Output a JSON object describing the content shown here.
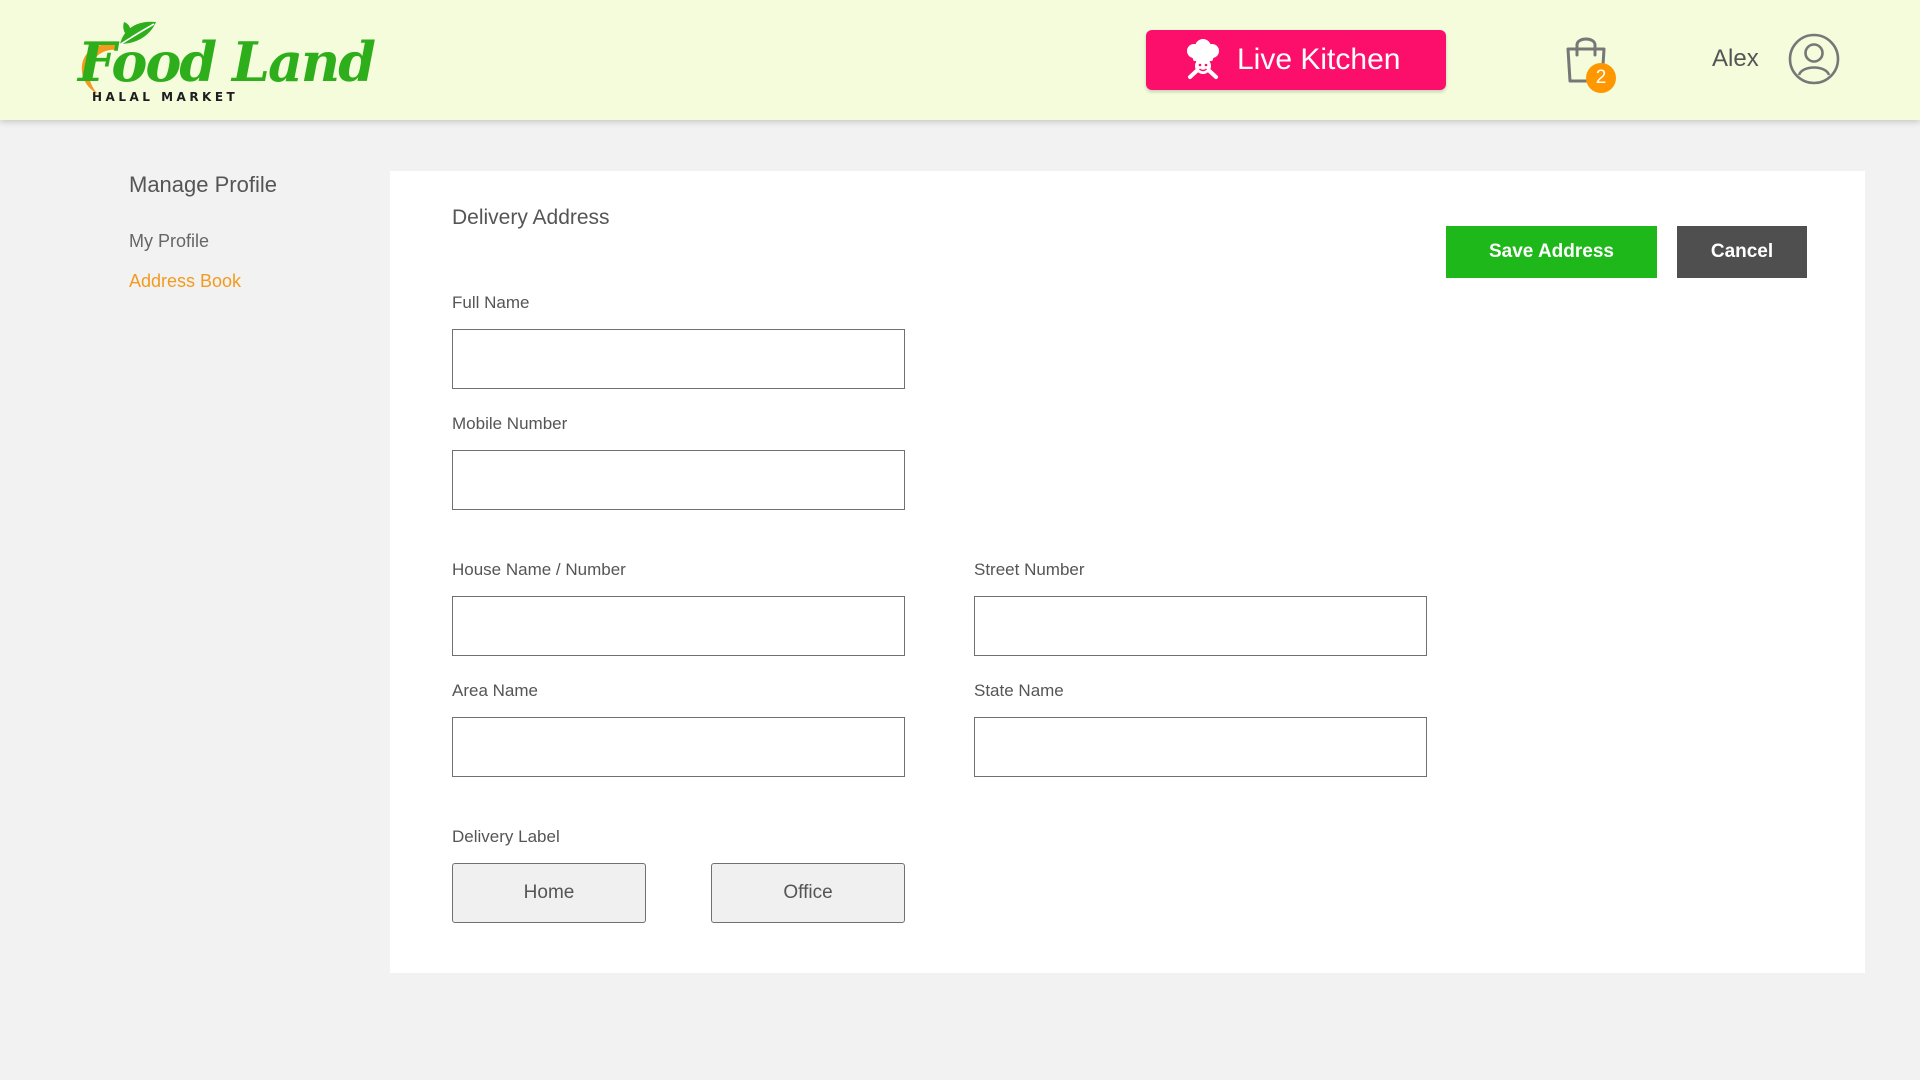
{
  "header": {
    "logo": {
      "title": "Food Land",
      "subtitle": "HALAL MARKET"
    },
    "live_kitchen_label": "Live Kitchen",
    "cart": {
      "icon": "shopping-bag-icon",
      "count": "2"
    },
    "user": {
      "name": "Alex",
      "icon": "user-circle-icon"
    }
  },
  "sidebar": {
    "title": "Manage Profile",
    "items": [
      {
        "label": "My Profile",
        "active": false
      },
      {
        "label": "Address Book",
        "active": true
      }
    ]
  },
  "form": {
    "title": "Delivery Address",
    "save_label": "Save Address",
    "cancel_label": "Cancel",
    "fields": {
      "full_name": {
        "label": "Full Name",
        "value": "",
        "placeholder": ""
      },
      "mobile": {
        "label": "Mobile Number",
        "value": "",
        "placeholder": ""
      },
      "house": {
        "label": "House Name / Number",
        "value": "",
        "placeholder": ""
      },
      "street": {
        "label": "Street Number",
        "value": "",
        "placeholder": ""
      },
      "area": {
        "label": "Area Name",
        "value": "",
        "placeholder": ""
      },
      "state": {
        "label": "State Name",
        "value": "",
        "placeholder": ""
      }
    },
    "delivery_label": {
      "label": "Delivery Label",
      "options": [
        "Home",
        "Office"
      ]
    }
  },
  "colors": {
    "header_bg": "#f4fcdc",
    "brand_green": "#2eae1a",
    "live_kitchen": "#fc0f6a",
    "badge": "#ff9800",
    "active_link": "#f39a1f",
    "save": "#1fb81a",
    "cancel": "#4f4f4f"
  }
}
